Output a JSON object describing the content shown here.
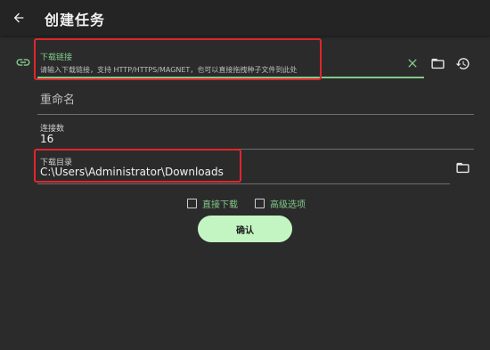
{
  "header": {
    "title": "创建任务",
    "back_icon": "arrow-left-icon"
  },
  "url_field": {
    "label": "下载链接",
    "placeholder": "请输入下载链接，支持 HTTP/HTTPS/MAGNET，也可以直接拖拽种子文件到此处",
    "link_icon": "link-icon",
    "clear_icon": "close-icon",
    "folder_icon": "folder-icon",
    "history_icon": "history-icon"
  },
  "rename_field": {
    "placeholder": "重命名"
  },
  "connections_field": {
    "label": "连接数",
    "value": "16"
  },
  "directory_field": {
    "label": "下载目录",
    "value": "C:\\Users\\Administrator\\Downloads",
    "folder_icon": "folder-icon"
  },
  "options": {
    "direct_download": "直接下载",
    "advanced": "高级选项"
  },
  "confirm_label": "确认",
  "colors": {
    "accent": "#82c989",
    "button_bg": "#c3f5c3",
    "background": "#2b2b2b",
    "highlight": "#e0262b"
  }
}
